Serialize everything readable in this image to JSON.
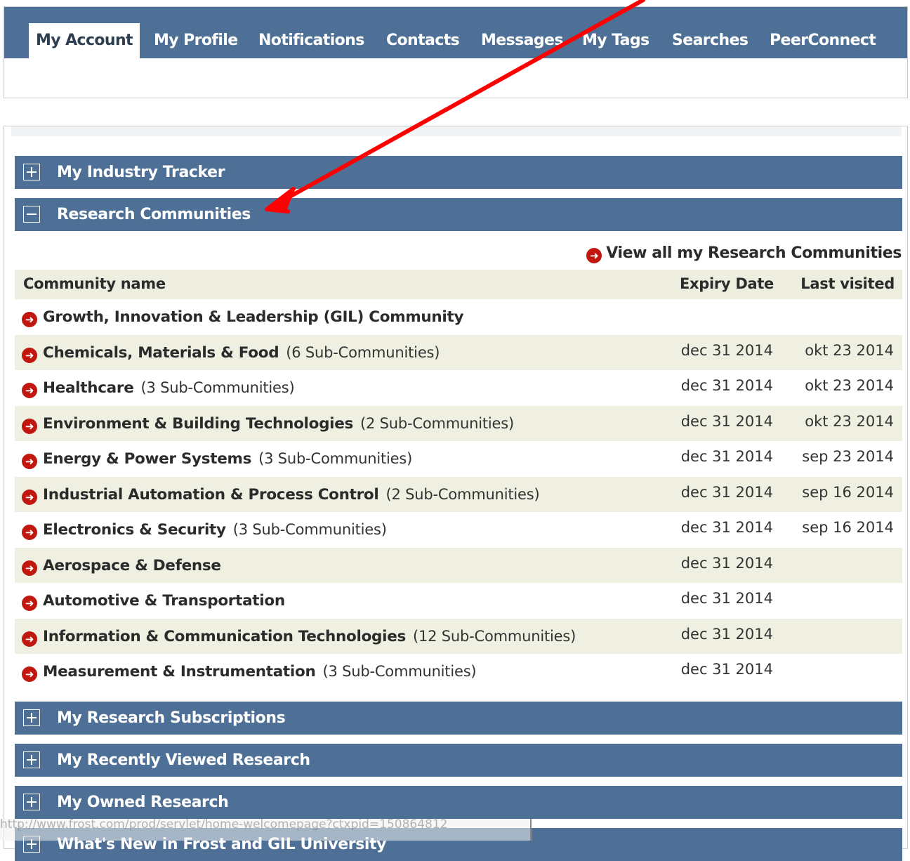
{
  "tabs": [
    {
      "label": "My Account",
      "active": true
    },
    {
      "label": "My Profile"
    },
    {
      "label": "Notifications"
    },
    {
      "label": "Contacts"
    },
    {
      "label": "Messages"
    },
    {
      "label": "My Tags"
    },
    {
      "label": "Searches"
    },
    {
      "label": "PeerConnect"
    }
  ],
  "sections": {
    "industry_tracker": {
      "title": "My Industry Tracker",
      "state": "collapsed"
    },
    "research_communities": {
      "title": "Research Communities",
      "state": "expanded"
    },
    "research_subscriptions": {
      "title": "My Research Subscriptions",
      "state": "collapsed"
    },
    "recently_viewed": {
      "title": "My Recently Viewed Research",
      "state": "collapsed"
    },
    "owned_research": {
      "title": "My Owned Research",
      "state": "collapsed"
    },
    "whats_new": {
      "title": "What's New in Frost and GIL University",
      "state": "collapsed"
    }
  },
  "communities": {
    "view_all_label": "View all my Research Communities",
    "columns": {
      "name": "Community name",
      "expiry": "Expiry Date",
      "visited": "Last visited"
    },
    "rows": [
      {
        "name": "Growth, Innovation & Leadership (GIL) Community",
        "sub": "",
        "expiry": "",
        "visited": ""
      },
      {
        "name": "Chemicals, Materials & Food",
        "sub": "(6 Sub-Communities)",
        "expiry": "dec 31 2014",
        "visited": "okt 23 2014"
      },
      {
        "name": "Healthcare",
        "sub": "(3 Sub-Communities)",
        "expiry": "dec 31 2014",
        "visited": "okt 23 2014"
      },
      {
        "name": "Environment & Building Technologies",
        "sub": "(2 Sub-Communities)",
        "expiry": "dec 31 2014",
        "visited": "okt 23 2014"
      },
      {
        "name": "Energy & Power Systems",
        "sub": "(3 Sub-Communities)",
        "expiry": "dec 31 2014",
        "visited": "sep 23 2014"
      },
      {
        "name": "Industrial Automation & Process Control",
        "sub": "(2 Sub-Communities)",
        "expiry": "dec 31 2014",
        "visited": "sep 16 2014"
      },
      {
        "name": "Electronics & Security",
        "sub": "(3 Sub-Communities)",
        "expiry": "dec 31 2014",
        "visited": "sep 16 2014"
      },
      {
        "name": "Aerospace & Defense",
        "sub": "",
        "expiry": "dec 31 2014",
        "visited": ""
      },
      {
        "name": "Automotive & Transportation",
        "sub": "",
        "expiry": "dec 31 2014",
        "visited": ""
      },
      {
        "name": "Information & Communication Technologies",
        "sub": "(12 Sub-Communities)",
        "expiry": "dec 31 2014",
        "visited": ""
      },
      {
        "name": "Measurement & Instrumentation",
        "sub": "(3 Sub-Communities)",
        "expiry": "dec 31 2014",
        "visited": ""
      }
    ]
  },
  "status_url": "http://www.frost.com/prod/servlet/home-welcomepage?ctxpid=150864812",
  "colors": {
    "header_blue": "#4f7096",
    "row_beige": "#f0f0e2",
    "arrow_red": "#c0170f",
    "annotation_red": "#ff0000"
  },
  "icons": {
    "toggle_expanded": "minus-box-icon",
    "toggle_collapsed": "plus-box-icon",
    "row_link": "red-circle-arrow-icon"
  }
}
